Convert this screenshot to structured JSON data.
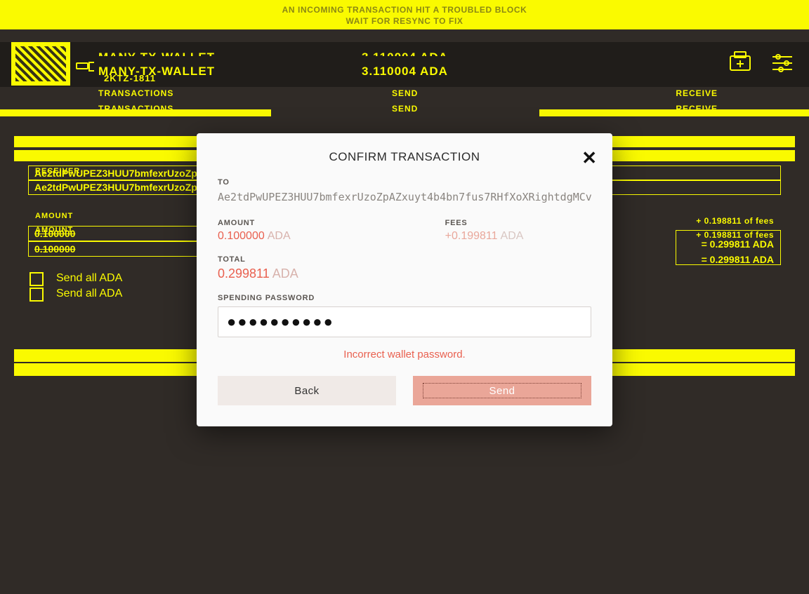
{
  "banner": {
    "line1": "AN INCOMING TRANSACTION HIT A TROUBLED BLOCK",
    "line2": "WAIT FOR RESYNC TO FIX"
  },
  "wallet": {
    "name": "MANY-TX-WALLET",
    "name_overlay": "MANY-TX-WALLET",
    "balance": "3.110004 ADA",
    "balance_overlay": "3.110004 ADA",
    "tag": "2KTZ-1811"
  },
  "nav": {
    "transactions": "TRANSACTIONS",
    "send": "SEND",
    "receive": "RECEIVE"
  },
  "form": {
    "receiver_label": "RECEIVER",
    "address": "Ae2tdPwUPEZ3HUU7bmfexrUzoZpAZxuyt4b4bn7fus7RHfXoXRightdgMCv",
    "amount_label": "AMOUNT",
    "amount_value": "0.100000",
    "fees_note": "+ 0.198811 of fees",
    "total_note": "= 0.299811 ADA",
    "send_all": "Send all ADA"
  },
  "modal": {
    "title": "CONFIRM TRANSACTION",
    "to_label": "TO",
    "to_value": "Ae2tdPwUPEZ3HUU7bmfexrUzoZpAZxuyt4b4bn7fus7RHfXoXRightdgMCv",
    "amount_label": "AMOUNT",
    "amount_value": "0.100000",
    "fees_label": "FEES",
    "fees_value": "+0.199811",
    "total_label": "TOTAL",
    "total_value": "0.299811",
    "ada": "ADA",
    "password_label": "SPENDING PASSWORD",
    "password_value": "●●●●●●●●●●",
    "error": "Incorrect wallet password.",
    "back": "Back",
    "send": "Send"
  }
}
